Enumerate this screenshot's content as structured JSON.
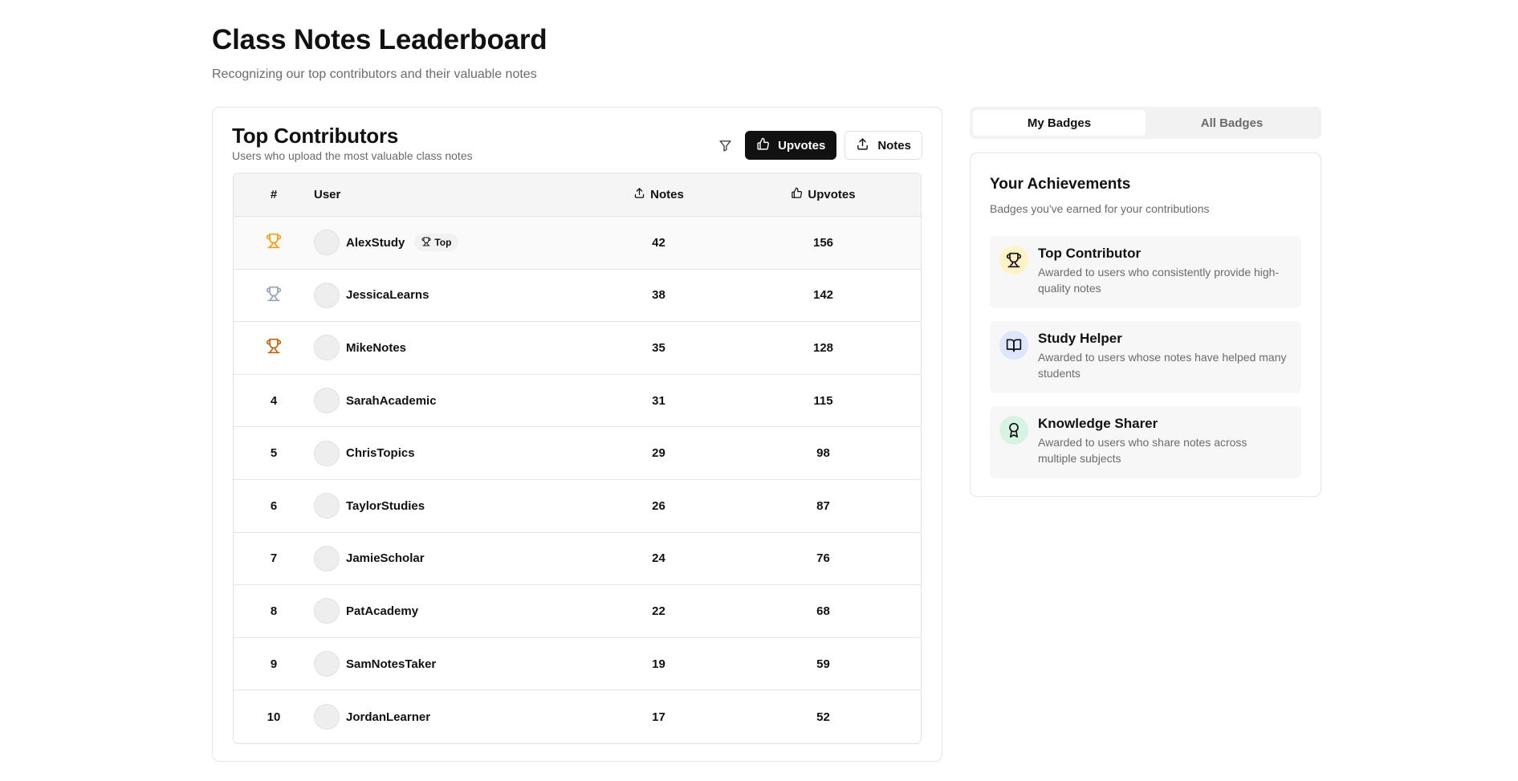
{
  "page": {
    "title": "Class Notes Leaderboard",
    "subtitle": "Recognizing our top contributors and their valuable notes"
  },
  "leaderboard": {
    "title": "Top Contributors",
    "subtitle": "Users who upload the most valuable class notes",
    "controls": {
      "filter_icon": "filter-icon",
      "upvotes_label": "Upvotes",
      "notes_label": "Notes",
      "active_sort": "Upvotes"
    },
    "columns": {
      "rank": "#",
      "user": "User",
      "notes": "Notes",
      "upvotes": "Upvotes"
    },
    "top_badge_label": "Top",
    "trophy_colors": {
      "gold": "#f59e0b",
      "silver": "#94a3b8",
      "bronze": "#c2620a"
    },
    "rows": [
      {
        "rank": "1",
        "trophy": "gold",
        "user": "AlexStudy",
        "notes": "42",
        "upvotes": "156",
        "top": true
      },
      {
        "rank": "2",
        "trophy": "silver",
        "user": "JessicaLearns",
        "notes": "38",
        "upvotes": "142",
        "top": false
      },
      {
        "rank": "3",
        "trophy": "bronze",
        "user": "MikeNotes",
        "notes": "35",
        "upvotes": "128",
        "top": false
      },
      {
        "rank": "4",
        "trophy": "",
        "user": "SarahAcademic",
        "notes": "31",
        "upvotes": "115",
        "top": false
      },
      {
        "rank": "5",
        "trophy": "",
        "user": "ChrisTopics",
        "notes": "29",
        "upvotes": "98",
        "top": false
      },
      {
        "rank": "6",
        "trophy": "",
        "user": "TaylorStudies",
        "notes": "26",
        "upvotes": "87",
        "top": false
      },
      {
        "rank": "7",
        "trophy": "",
        "user": "JamieScholar",
        "notes": "24",
        "upvotes": "76",
        "top": false
      },
      {
        "rank": "8",
        "trophy": "",
        "user": "PatAcademy",
        "notes": "22",
        "upvotes": "68",
        "top": false
      },
      {
        "rank": "9",
        "trophy": "",
        "user": "SamNotesTaker",
        "notes": "19",
        "upvotes": "59",
        "top": false
      },
      {
        "rank": "10",
        "trophy": "",
        "user": "JordanLearner",
        "notes": "17",
        "upvotes": "52",
        "top": false
      }
    ]
  },
  "badges": {
    "tabs": [
      {
        "label": "My Badges",
        "active": true
      },
      {
        "label": "All Badges",
        "active": false
      }
    ],
    "title": "Your Achievements",
    "subtitle": "Badges you've earned for your contributions",
    "items": [
      {
        "name": "Top Contributor",
        "desc": "Awarded to users who consistently provide high-quality notes",
        "icon": "trophy-icon",
        "bg": "#fdf3c8",
        "color": "#111111"
      },
      {
        "name": "Study Helper",
        "desc": "Awarded to users whose notes have helped many students",
        "icon": "book-icon",
        "bg": "#dde6fb",
        "color": "#111111"
      },
      {
        "name": "Knowledge Sharer",
        "desc": "Awarded to users who share notes across multiple subjects",
        "icon": "award-icon",
        "bg": "#d7f3e1",
        "color": "#111111"
      }
    ]
  }
}
